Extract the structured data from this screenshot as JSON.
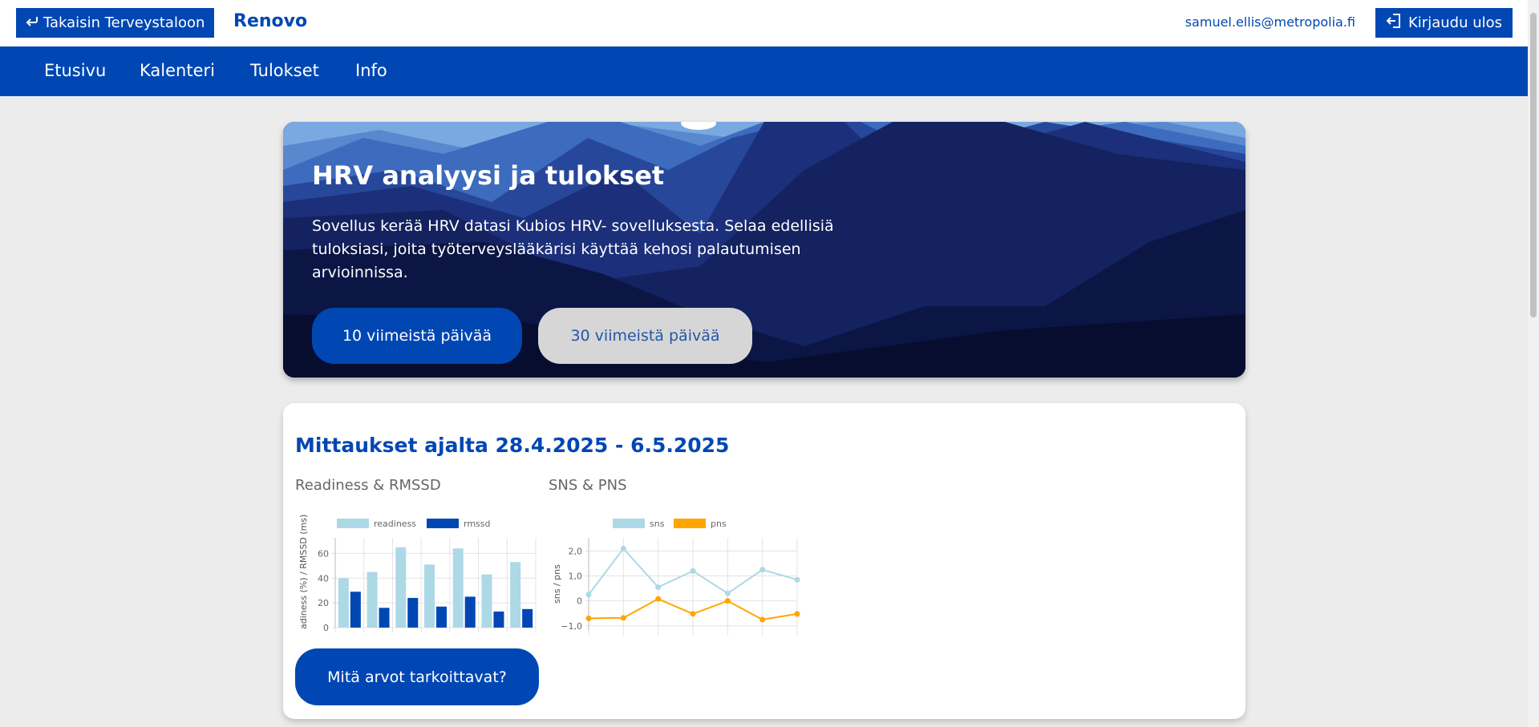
{
  "topbar": {
    "back_label": "Takaisin Terveystaloon",
    "brand": "Renovo",
    "email": "samuel.ellis@metropolia.fi",
    "logout_label": "Kirjaudu ulos"
  },
  "nav": {
    "items": [
      {
        "label": "Etusivu"
      },
      {
        "label": "Kalenteri"
      },
      {
        "label": "Tulokset"
      },
      {
        "label": "Info"
      }
    ]
  },
  "hero": {
    "title": "HRV analyysi ja tulokset",
    "text": "Sovellus kerää HRV datasi Kubios HRV- sovelluksesta. Selaa edellisiä tuloksiasi, joita työterveyslääkärisi käyttää kehosi palautumisen arvioinnissa.",
    "btn_10": "10 viimeistä päivää",
    "btn_30": "30 viimeistä päivää"
  },
  "results": {
    "title": "Mittaukset ajalta 28.4.2025 - 6.5.2025",
    "chart1_title": "Readiness & RMSSD",
    "chart2_title": "SNS & PNS",
    "help_label": "Mitä arvot tarkoittavat?"
  },
  "colors": {
    "brand": "#0047b3",
    "readiness": "#add8e6",
    "rmssd": "#0047b3",
    "sns": "#add8e6",
    "pns": "#ffa500"
  },
  "chart_data": [
    {
      "type": "bar",
      "title": "Readiness & RMSSD",
      "xlabel": "",
      "ylabel": "adiness (%) / RMSSD (ms)",
      "ylim": [
        0,
        70
      ],
      "yticks": [
        "0",
        "20",
        "40",
        "60"
      ],
      "legend_position": "top",
      "grid": true,
      "series": [
        {
          "name": "readiness",
          "values": [
            40,
            45,
            65,
            51,
            64,
            43,
            53
          ]
        },
        {
          "name": "rmssd",
          "values": [
            29,
            16,
            24,
            17,
            25,
            13,
            15
          ]
        }
      ]
    },
    {
      "type": "line",
      "title": "SNS & PNS",
      "xlabel": "",
      "ylabel": "sns / pns",
      "ylim": [
        -1.2,
        2.4
      ],
      "yticks": [
        "−1,0",
        "0",
        "1,0",
        "2,0"
      ],
      "legend_position": "top",
      "grid": true,
      "series": [
        {
          "name": "sns",
          "values": [
            0.25,
            2.1,
            0.55,
            1.2,
            0.3,
            1.25,
            0.85
          ]
        },
        {
          "name": "pns",
          "values": [
            -0.7,
            -0.68,
            0.08,
            -0.52,
            0.0,
            -0.75,
            -0.52
          ]
        }
      ]
    }
  ]
}
